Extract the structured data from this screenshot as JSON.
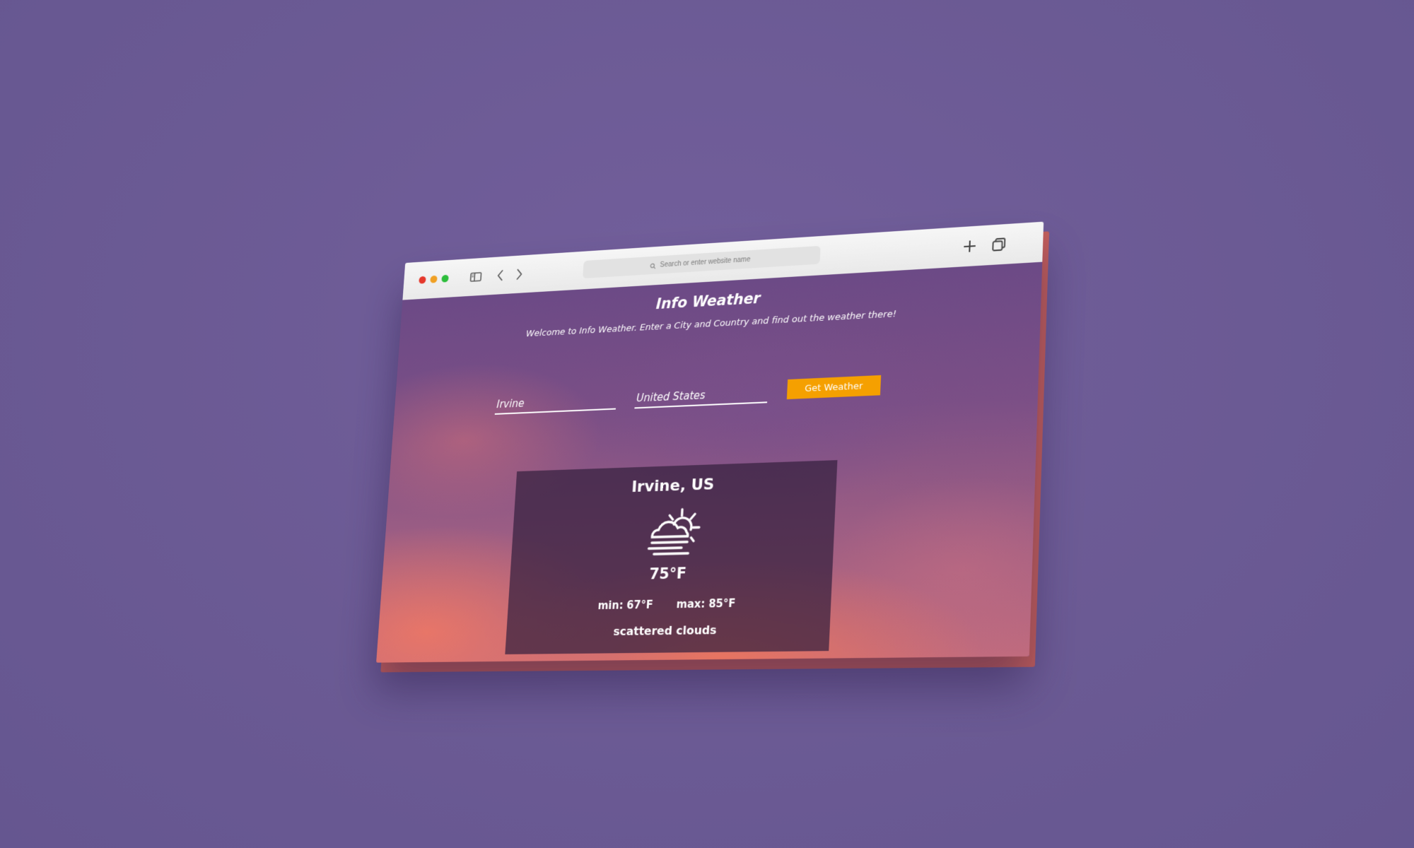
{
  "browser": {
    "address_placeholder": "Search or enter website name",
    "icons": [
      "sidebar-icon",
      "back-icon",
      "forward-icon",
      "search-icon",
      "plus-icon",
      "tabs-icon"
    ]
  },
  "page": {
    "title": "Info Weather",
    "subtitle": "Welcome to Info Weather. Enter a City and Country and find out the weather there!"
  },
  "form": {
    "city_value": "Irvine",
    "country_value": "United States",
    "submit_label": "Get Weather"
  },
  "weather": {
    "location": "Irvine, US",
    "icon": "partly-cloudy-fog-icon",
    "temperature": "75°F",
    "min": "min: 67°F",
    "max": "max: 85°F",
    "description": "scattered clouds"
  },
  "colors": {
    "background": "#6b5b95",
    "accent_button": "#f5a000",
    "titlebar": "#efefef"
  }
}
